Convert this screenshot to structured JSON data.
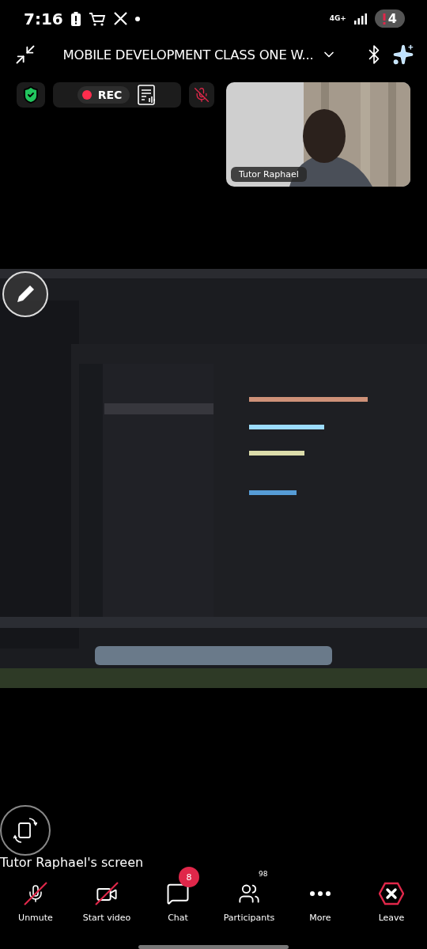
{
  "status_bar": {
    "time": "7:16",
    "network": "4G+",
    "badge": "4"
  },
  "header": {
    "title": "MOBILE DEVELOPMENT CLASS ONE W..."
  },
  "controls": {
    "rec_label": "REC",
    "mic_muted": true
  },
  "video_tile": {
    "name": "Tutor Raphael",
    "kind": "picture"
  },
  "shared_screen": {
    "kind": "picture",
    "owner": "Tutor Raphael's screen"
  },
  "toolbar": [
    {
      "kind": "mic",
      "label": "Unmute",
      "off": true
    },
    {
      "kind": "video",
      "label": "Start video",
      "off": true
    },
    {
      "kind": "chat",
      "label": "Chat",
      "badge": "8"
    },
    {
      "kind": "participants",
      "label": "Participants",
      "count": "98"
    },
    {
      "kind": "more",
      "label": "More"
    },
    {
      "kind": "leave",
      "label": "Leave"
    }
  ]
}
